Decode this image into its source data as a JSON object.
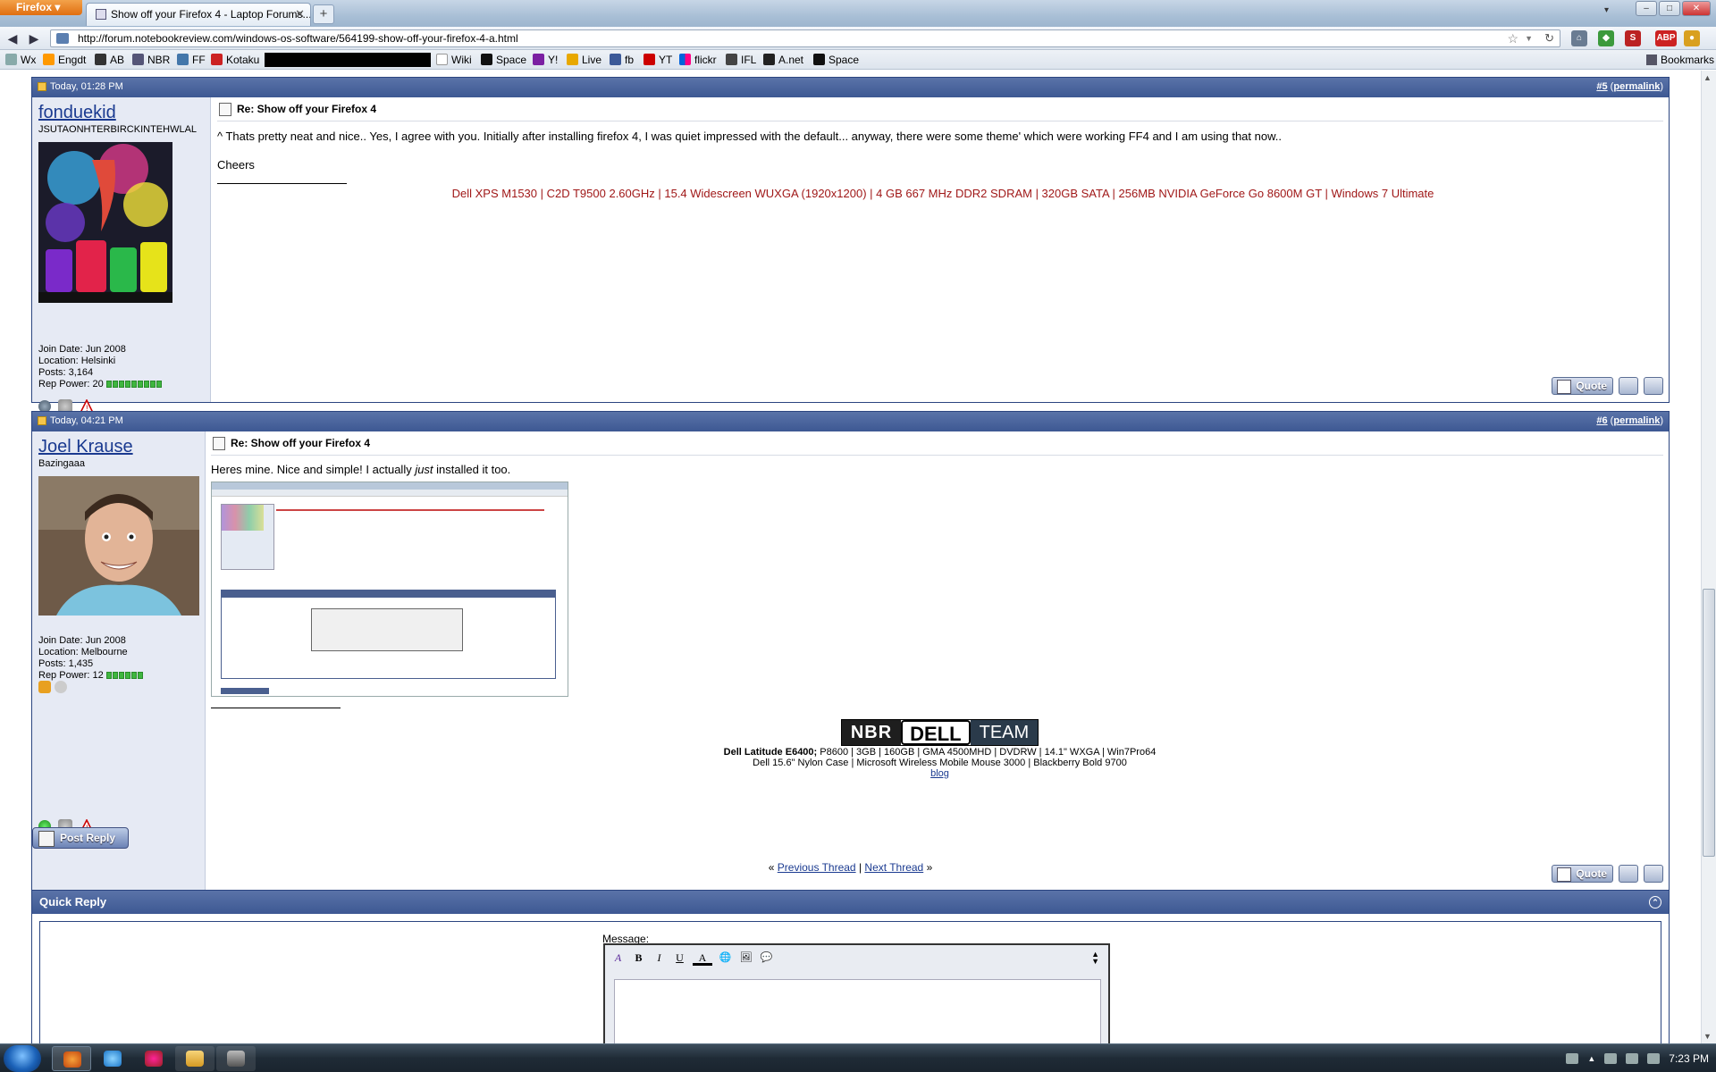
{
  "browser": {
    "menu_label": "Firefox",
    "tab_title": "Show off your Firefox 4 - Laptop Forums...",
    "new_tab": "+",
    "url": "http://forum.notebookreview.com/windows-os-software/564199-show-off-your-firefox-4-a.html",
    "window_controls": [
      "–",
      "□",
      "✕"
    ]
  },
  "bookmarks": {
    "items": [
      "Wx",
      "Engdt",
      "AB",
      "NBR",
      "FF",
      "Kotaku",
      "Wiki",
      "Space",
      "Y!",
      "Live",
      "fb",
      "YT",
      "flickr",
      "IFL",
      "A.net",
      "Space"
    ],
    "right_label": "Bookmarks"
  },
  "post5": {
    "date": "Today, 01:28 PM",
    "number": "#5",
    "permalink": "permalink",
    "username": "fonduekid",
    "usertitle": "JSUTAONHTERBIRCKINTEHWLAL",
    "join": "Join Date: Jun 2008",
    "location": "Location: Helsinki",
    "posts": "Posts: 3,164",
    "rep": "Rep Power: 20",
    "rep_segments": 9,
    "title": "Re: Show off your Firefox 4",
    "message": "^ Thats pretty neat and nice.. Yes, I agree with you. Initially after installing firefox 4, I was quiet impressed with the default... anyway, there were some theme' which were working FF4 and I am using that now..",
    "cheers": "Cheers",
    "signature": "Dell XPS M1530 | C2D T9500 2.60GHz | 15.4 Widescreen WUXGA (1920x1200) | 4 GB 667 MHz DDR2 SDRAM | 320GB SATA | 256MB NVIDIA GeForce Go 8600M GT | Windows 7 Ultimate",
    "quote": "Quote"
  },
  "post6": {
    "date": "Today, 04:21 PM",
    "number": "#6",
    "permalink": "permalink",
    "username": "Joel Krause",
    "usertitle": "Bazingaaa",
    "join": "Join Date: Jun 2008",
    "location": "Location: Melbourne",
    "posts": "Posts: 1,435",
    "rep": "Rep Power: 12",
    "rep_segments": 6,
    "title": "Re: Show off your Firefox 4",
    "message_a": "Heres mine. Nice and simple! I actually ",
    "message_em": "just",
    "message_b": " installed it too.",
    "sig_logo": [
      "NBR",
      "DELL",
      "TEAM"
    ],
    "sig_line1_bold": "Dell Latitude E6400;",
    "sig_line1": " P8600 | 3GB | 160GB | GMA 4500MHD | DVDRW | 14.1\" WXGA | Win7Pro64",
    "sig_line2": "Dell 15.6\" Nylon Case | Microsoft Wireless Mobile Mouse 3000 | Blackberry Bold 9700",
    "sig_link": "blog",
    "quote": "Quote"
  },
  "post_reply": "Post Reply",
  "thread_nav": {
    "prev": "Previous Thread",
    "sep": "|",
    "next": "Next Thread",
    "lq": "«",
    "rq": "»"
  },
  "quick_reply": {
    "title": "Quick Reply",
    "message_label": "Message:",
    "tools": [
      "A",
      "B",
      "I",
      "U",
      "A",
      "🌐",
      "🖼",
      "💬"
    ]
  },
  "taskbar": {
    "time": "7:23 PM"
  },
  "colors": {
    "header_blue": "#3d5893",
    "sig_red": "#a01818",
    "link_blue": "#1a3a90"
  }
}
